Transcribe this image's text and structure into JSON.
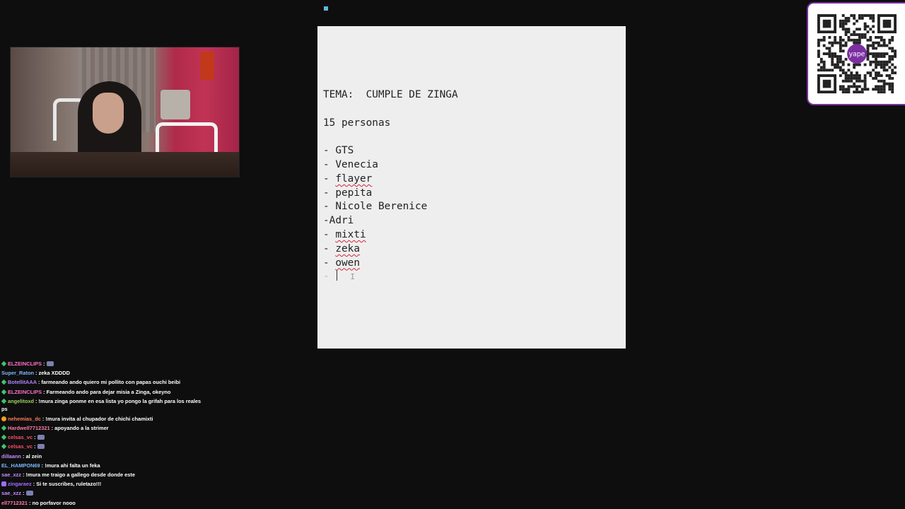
{
  "note": {
    "lines": [
      "TEMA:  CUMPLE DE ZINGA",
      "",
      "15 personas",
      "",
      "- GTS",
      "- Venecia",
      "- flayer",
      "- pepita",
      "- Nicole Berenice",
      "-Adri",
      "- mixti",
      "- zeka",
      "- owen",
      "-"
    ]
  },
  "qr": {
    "brand": "yape",
    "brand_color": "#7b2fa1"
  },
  "chat": {
    "messages": [
      {
        "user": "ELZEINCLIPS",
        "text": "",
        "color": "#ff6ec7",
        "badge": "b-green",
        "emote": true
      },
      {
        "user": "Super_Raton",
        "text": "zeka XDDDD",
        "color": "#7ab8ff",
        "badge": ""
      },
      {
        "user": "BotellitAAA",
        "text": "farmeando ando quiero mi pollito con papas ouchi beibi",
        "color": "#b084ff",
        "badge": "b-green"
      },
      {
        "user": "ELZEINCLIPS",
        "text": "Farmeando ando para dejar misia a Zinga, okeyno",
        "color": "#ff6ec7",
        "badge": "b-green"
      },
      {
        "user": "angelitoxd",
        "text": "!mura zinga ponme en esa lista yo pongo la grifah para los reales ps",
        "color": "#9fd25f",
        "badge": "b-green",
        "wrap": true
      },
      {
        "user": "nehemias_dc",
        "text": "!mura invita al chupador de chichi chamixti",
        "color": "#ff7a59",
        "badge": "b-orange"
      },
      {
        "user": "Hardwell7712321",
        "text": "apoyando a la strimer",
        "color": "#ff7aa8",
        "badge": "b-green"
      },
      {
        "user": "celsas_vc",
        "text": "",
        "color": "#ff4f6a",
        "badge": "b-green",
        "emote": true
      },
      {
        "user": "celsas_vc",
        "text": "",
        "color": "#ff4f6a",
        "badge": "b-green",
        "emote": true
      },
      {
        "user": "dillaann",
        "text": "al zein",
        "color": "#c58bff",
        "badge": ""
      },
      {
        "user": "EL_HAMPON69",
        "text": "!mura ahi falta un feka",
        "color": "#7ab8ff",
        "badge": ""
      },
      {
        "user": "sae_xzz",
        "text": "!mura me traigo a gallego desde donde este",
        "color": "#c58bff",
        "badge": ""
      },
      {
        "user": "zingaraez",
        "text": "Si te suscribes, ruletazo!!!",
        "color": "#a06cff",
        "badge": "b-purple"
      },
      {
        "user": "sae_xzz",
        "text": "",
        "color": "#c58bff",
        "badge": "",
        "emote": true
      },
      {
        "user": "ell7712321",
        "text": "no porfavor nooo",
        "color": "#ff7aa8",
        "badge": ""
      }
    ]
  }
}
